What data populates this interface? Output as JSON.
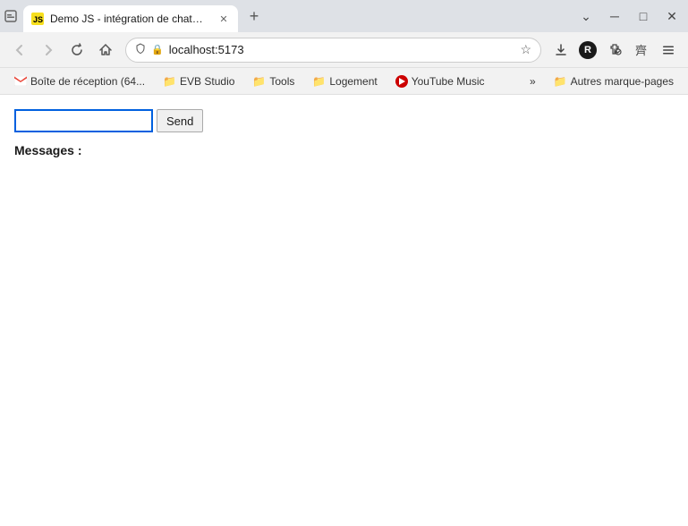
{
  "browser": {
    "tab": {
      "title": "Demo JS - intégration de chatGTP p",
      "favicon": "JS"
    },
    "new_tab_label": "+",
    "nav": {
      "back_label": "←",
      "forward_label": "→",
      "reload_label": "↻",
      "home_label": "⌂",
      "address": "localhost:5173",
      "star_label": "☆",
      "shield_label": "🛡",
      "download_label": "⬇",
      "profile_label": "R",
      "extensions_label": "⚙",
      "puzzle_label": "☰",
      "menu_label": "≡"
    },
    "bookmarks": [
      {
        "id": "gmail",
        "type": "gmail",
        "label": "Boîte de réception (64..."
      },
      {
        "id": "evb-studio",
        "type": "folder",
        "label": "EVB Studio"
      },
      {
        "id": "tools",
        "type": "folder",
        "label": "Tools"
      },
      {
        "id": "logement",
        "type": "folder",
        "label": "Logement"
      },
      {
        "id": "youtube-music",
        "type": "ytmusic",
        "label": "YouTube Music"
      }
    ],
    "bookmarks_overflow": {
      "chevron_label": "»",
      "other_label": "Autres marque-pages"
    }
  },
  "page": {
    "input_placeholder": "",
    "send_button_label": "Send",
    "messages_label": "Messages :"
  }
}
